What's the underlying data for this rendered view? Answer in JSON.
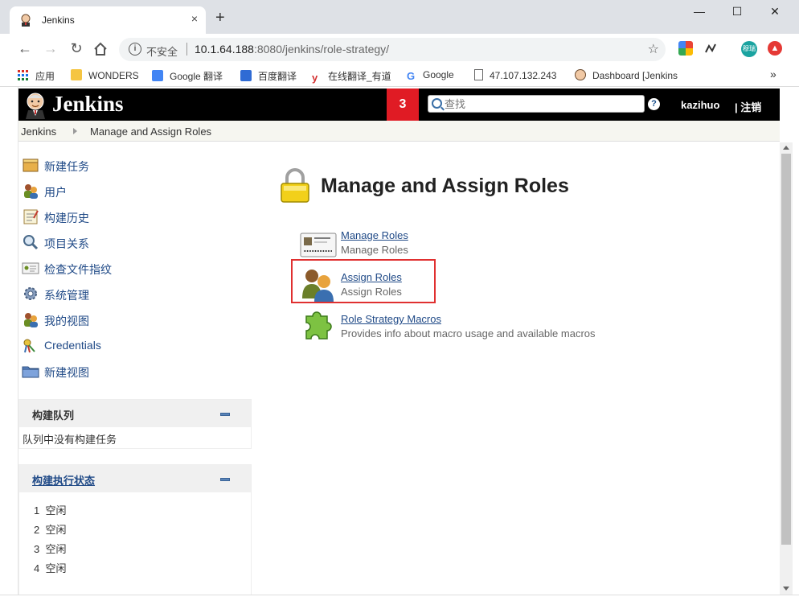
{
  "browser": {
    "tab_title": "Jenkins",
    "tab_close": "×",
    "new_tab": "+",
    "window_minimize": "—",
    "window_maximize": "☐",
    "window_close": "✕",
    "security_label": "不安全",
    "url_host": "10.1.64.188",
    "url_rest": ":8080/jenkins/role-strategy/",
    "bookmarks": [
      {
        "label": "应用"
      },
      {
        "label": "WONDERS"
      },
      {
        "label": "Google 翻译"
      },
      {
        "label": "百度翻译"
      },
      {
        "label": "在线翻译_有道"
      },
      {
        "label": "Google"
      },
      {
        "label": "47.107.132.243"
      },
      {
        "label": "Dashboard [Jenkins"
      }
    ],
    "bookmarks_more": "»",
    "ext_badge": "穆瑞"
  },
  "header": {
    "logo_text": "Jenkins",
    "notification_count": "3",
    "search_placeholder": "查找",
    "help": "?",
    "username": "kazihuo",
    "logout": "| 注销"
  },
  "breadcrumb": {
    "root": "Jenkins",
    "current": "Manage and Assign Roles"
  },
  "sidebar": {
    "tasks": [
      {
        "label": "新建任务",
        "icon": "new-item-icon"
      },
      {
        "label": "用户",
        "icon": "users-icon"
      },
      {
        "label": "构建历史",
        "icon": "build-history-icon"
      },
      {
        "label": "项目关系",
        "icon": "search-icon"
      },
      {
        "label": "检查文件指纹",
        "icon": "fingerprint-icon"
      },
      {
        "label": "系统管理",
        "icon": "gear-icon"
      },
      {
        "label": "我的视图",
        "icon": "my-views-icon"
      },
      {
        "label": "Credentials",
        "icon": "credentials-icon"
      },
      {
        "label": "新建视图",
        "icon": "folder-icon"
      }
    ],
    "build_queue": {
      "title": "构建队列",
      "empty_text": "队列中没有构建任务"
    },
    "executors": {
      "title": "构建执行状态",
      "items": [
        {
          "num": "1",
          "status": "空闲"
        },
        {
          "num": "2",
          "status": "空闲"
        },
        {
          "num": "3",
          "status": "空闲"
        },
        {
          "num": "4",
          "status": "空闲"
        }
      ]
    }
  },
  "main": {
    "title": "Manage and Assign Roles",
    "items": [
      {
        "link": "Manage Roles",
        "desc": "Manage Roles",
        "icon": "id-card-icon"
      },
      {
        "link": "Assign Roles",
        "desc": "Assign Roles",
        "icon": "assign-users-icon"
      },
      {
        "link": "Role Strategy Macros",
        "desc": "Provides info about macro usage and available macros",
        "icon": "puzzle-piece-icon"
      }
    ]
  },
  "colors": {
    "header_bg": "#000000",
    "badge_bg": "#e01b24",
    "link": "#204a87",
    "highlight": "#e03030"
  }
}
